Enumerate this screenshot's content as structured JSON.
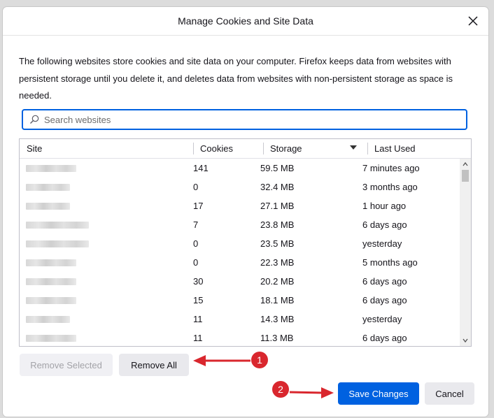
{
  "dialog": {
    "title": "Manage Cookies and Site Data",
    "description": "The following websites store cookies and site data on your computer. Firefox keeps data from websites with persistent storage until you delete it, and deletes data from websites with non-persistent storage as space is needed."
  },
  "search": {
    "placeholder": "Search websites"
  },
  "table": {
    "columns": [
      "Site",
      "Cookies",
      "Storage",
      "Last Used"
    ],
    "sorted_by": "Storage",
    "sort_direction": "descending",
    "rows": [
      {
        "site": "",
        "cookies": "141",
        "storage": "59.5 MB",
        "last_used": "7 minutes ago"
      },
      {
        "site": "",
        "cookies": "0",
        "storage": "32.4 MB",
        "last_used": "3 months ago"
      },
      {
        "site": "",
        "cookies": "17",
        "storage": "27.1 MB",
        "last_used": "1 hour ago"
      },
      {
        "site": "",
        "cookies": "7",
        "storage": "23.8 MB",
        "last_used": "6 days ago"
      },
      {
        "site": "",
        "cookies": "0",
        "storage": "23.5 MB",
        "last_used": "yesterday"
      },
      {
        "site": "",
        "cookies": "0",
        "storage": "22.3 MB",
        "last_used": "5 months ago"
      },
      {
        "site": "",
        "cookies": "30",
        "storage": "20.2 MB",
        "last_used": "6 days ago"
      },
      {
        "site": "",
        "cookies": "15",
        "storage": "18.1 MB",
        "last_used": "6 days ago"
      },
      {
        "site": "",
        "cookies": "11",
        "storage": "14.3 MB",
        "last_used": "yesterday"
      },
      {
        "site": "",
        "cookies": "11",
        "storage": "11.3 MB",
        "last_used": "6 days ago"
      }
    ]
  },
  "buttons": {
    "remove_selected": "Remove Selected",
    "remove_all": "Remove All",
    "save_changes": "Save Changes",
    "cancel": "Cancel"
  },
  "annotations": {
    "badge_1": "1",
    "badge_2": "2",
    "color": "#d9272e"
  },
  "colors": {
    "accent": "#0061e0",
    "annotation_red": "#d9272e"
  }
}
